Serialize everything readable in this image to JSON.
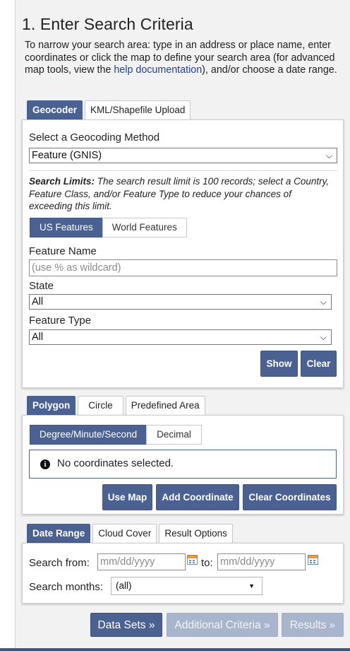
{
  "section_title": "1. Enter Search Criteria",
  "intro": {
    "text_before": "To narrow your search area: type in an address or place name, enter coordinates or click the map to define your search area (for advanced map tools, view the ",
    "link": "help documentation",
    "text_after": "), and/or choose a date range."
  },
  "geo_tabs": [
    "Geocoder",
    "KML/Shapefile Upload"
  ],
  "geocoder": {
    "method_label": "Select a Geocoding Method",
    "method_value": "Feature (GNIS)",
    "limits_bold": "Search Limits:",
    "limits_text": " The search result limit is 100 records; select a Country, Feature Class, and/or Feature Type to reduce your chances of exceeding this limit.",
    "feature_toggle": [
      "US Features",
      "World Features"
    ],
    "feature_name_label": "Feature Name",
    "feature_name_placeholder": "(use % as wildcard)",
    "state_label": "State",
    "state_value": "All",
    "feature_type_label": "Feature Type",
    "feature_type_value": "All",
    "show_button": "Show",
    "clear_button": "Clear"
  },
  "area_tabs": [
    "Polygon",
    "Circle",
    "Predefined Area"
  ],
  "polygon": {
    "coord_format": [
      "Degree/Minute/Second",
      "Decimal"
    ],
    "no_coords": "No coordinates selected.",
    "use_map": "Use Map",
    "add_coordinate": "Add Coordinate",
    "clear_coordinates": "Clear Coordinates"
  },
  "date_tabs": [
    "Date Range",
    "Cloud Cover",
    "Result Options"
  ],
  "date_range": {
    "from_label": "Search from:",
    "from_placeholder": "mm/dd/yyyy",
    "to_label": "to:",
    "to_placeholder": "mm/dd/yyyy",
    "months_label": "Search months:",
    "months_value": "(all)"
  },
  "nav": {
    "data_sets": "Data Sets »",
    "additional_criteria": "Additional Criteria »",
    "results": "Results »"
  },
  "colors": {
    "accent": "#4a6192",
    "disabled": "#a9b5cc",
    "background": "#f2f2f2"
  }
}
